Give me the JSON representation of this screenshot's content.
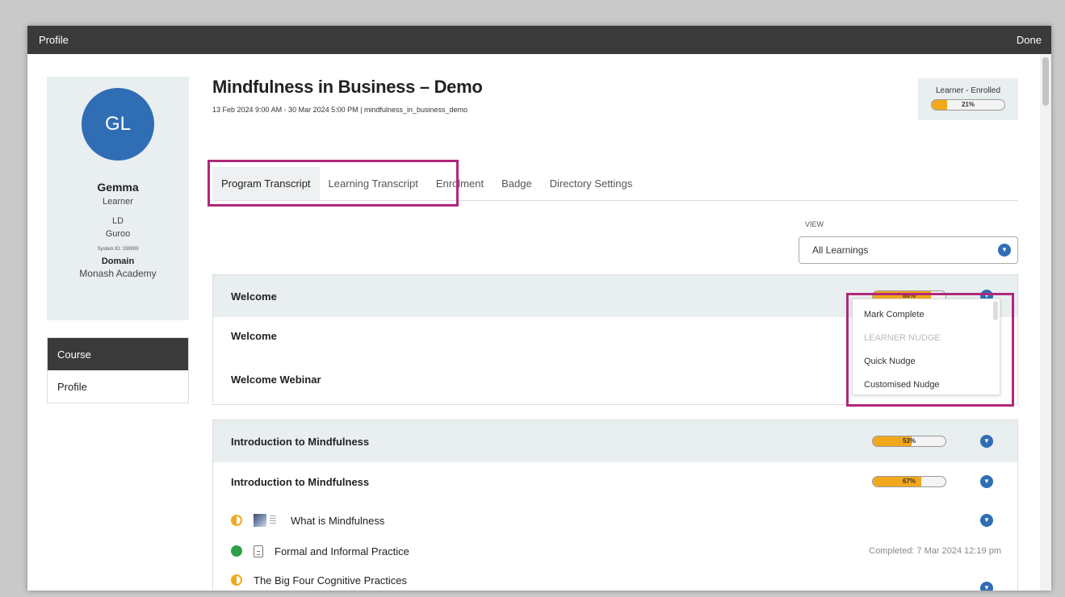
{
  "window": {
    "title": "Profile",
    "done_label": "Done"
  },
  "profile": {
    "initials": "GL",
    "name": "Gemma",
    "role": "Learner",
    "org_code": "LD",
    "org_name": "Guroo",
    "system_id": "System ID: 159909",
    "domain_label": "Domain",
    "domain_value": "Monash Academy"
  },
  "side_nav": {
    "active": "Course",
    "items": [
      "Profile"
    ]
  },
  "course": {
    "title": "Mindfulness in Business – Demo",
    "subtitle": "13 Feb 2024 9:00 AM - 30 Mar 2024 5:00 PM | mindfulness_in_business_demo",
    "status_label": "Learner - Enrolled",
    "progress": 21,
    "progress_text": "21%"
  },
  "tabs": [
    "Program Transcript",
    "Learning Transcript",
    "Enrolment",
    "Badge",
    "Directory Settings"
  ],
  "view": {
    "label": "VIEW",
    "selected": "All Learnings"
  },
  "sections": [
    {
      "title": "Welcome",
      "progress": 80,
      "progress_text": "80%",
      "rows": [
        "Welcome",
        "Welcome Webinar"
      ]
    },
    {
      "title": "Introduction to Mindfulness",
      "progress": 53,
      "progress_text": "53%",
      "sub_title": "Introduction to Mindfulness",
      "sub_progress": 67,
      "sub_progress_text": "67%",
      "items": [
        {
          "label": "What is Mindfulness",
          "status": "in-progress"
        },
        {
          "label": "Formal and Informal Practice",
          "status": "completed",
          "completed_text": "Completed: 7 Mar 2024 12:19 pm"
        },
        {
          "label": "The Big Four Cognitive Practices",
          "status": "in-progress"
        }
      ]
    }
  ],
  "dropdown_menu": [
    "Mark Complete",
    "LEARNER NUDGE",
    "Quick Nudge",
    "Customised Nudge"
  ],
  "colors": {
    "accent": "#2f6db5",
    "progress": "#f2a81d",
    "highlight": "#b0287a",
    "header": "#3a3a3a",
    "complete": "#2ea04a"
  }
}
